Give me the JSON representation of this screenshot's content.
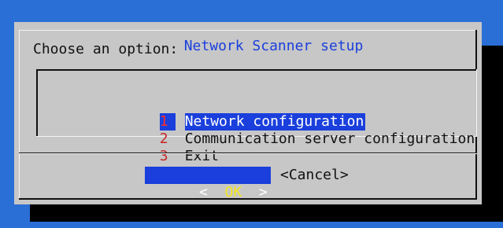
{
  "dialog": {
    "title": "Network Scanner setup",
    "prompt": "Choose an option:"
  },
  "menu": {
    "items": [
      {
        "number": "1",
        "label": "Network configuration",
        "selected": true
      },
      {
        "number": "2",
        "label": "Communication server configuration",
        "selected": false
      },
      {
        "number": "3",
        "label": "Exit",
        "selected": false
      }
    ]
  },
  "buttons": {
    "ok_left": "<  ",
    "ok_label": "OK",
    "ok_right": "  >",
    "cancel_label": "<Cancel>"
  },
  "colors": {
    "screen_background": "#2a6fd6",
    "dialog_background": "#c7c7c7",
    "title_color": "#1a3fdc",
    "selection_background": "#1a3fdc",
    "selected_text": "#ffffff",
    "number_color": "#c42626",
    "ok_highlight": "#f4e61f"
  }
}
